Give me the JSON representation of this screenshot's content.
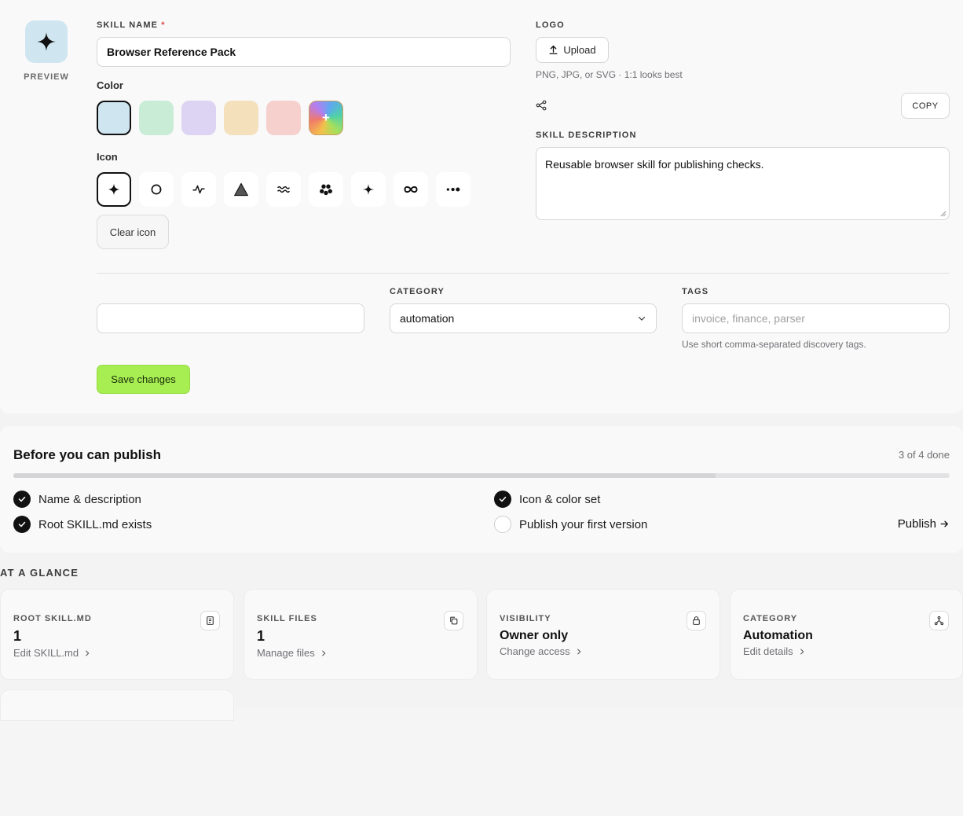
{
  "preview": {
    "label": "PREVIEW",
    "icon": "sparkle-icon"
  },
  "form": {
    "skill_name_label": "SKILL NAME",
    "required_mark": "*",
    "skill_name_value": "Browser Reference Pack",
    "color_label": "Color",
    "colors": [
      "#cfe6f1",
      "#c8ecd6",
      "#ddd3f3",
      "#f5e0bc",
      "#f5d0cc"
    ],
    "custom_color_label": "+",
    "icon_label": "Icon",
    "icons": [
      "sparkle-icon",
      "refresh-circle-icon",
      "pulse-icon",
      "triangle-icon",
      "waves-icon",
      "dots-cluster-icon",
      "sparkle-small-icon",
      "infinity-icon",
      "more-dots-icon"
    ],
    "clear_icon_label": "Clear icon",
    "logo_label": "LOGO",
    "upload_label": "Upload",
    "logo_hint": "PNG, JPG, or SVG · 1:1 looks best",
    "copy_label": "COPY",
    "description_label": "SKILL DESCRIPTION",
    "description_value": "Reusable browser skill for publishing checks.",
    "category_label": "CATEGORY",
    "category_value": "automation",
    "tags_label": "TAGS",
    "tags_placeholder": "invoice, finance, parser",
    "tags_hint": "Use short comma-separated discovery tags.",
    "save_label": "Save changes"
  },
  "publish": {
    "title": "Before you can publish",
    "count": "3 of 4 done",
    "progress": 0.75,
    "items": [
      {
        "label": "Name & description",
        "done": true
      },
      {
        "label": "Icon & color set",
        "done": true
      },
      {
        "label": "Root SKILL.md exists",
        "done": true
      },
      {
        "label": "Publish your first version",
        "done": false
      }
    ],
    "publish_link": "Publish"
  },
  "glance": {
    "title": "AT A GLANCE",
    "cards": [
      {
        "label": "ROOT SKILL.MD",
        "value": "1",
        "link": "Edit SKILL.md",
        "icon": "document-icon"
      },
      {
        "label": "SKILL FILES",
        "value": "1",
        "link": "Manage files",
        "icon": "copy-icon"
      },
      {
        "label": "VISIBILITY",
        "value": "Owner only",
        "link": "Change access",
        "icon": "lock-icon"
      },
      {
        "label": "CATEGORY",
        "value": "Automation",
        "link": "Edit details",
        "icon": "network-icon"
      }
    ]
  }
}
